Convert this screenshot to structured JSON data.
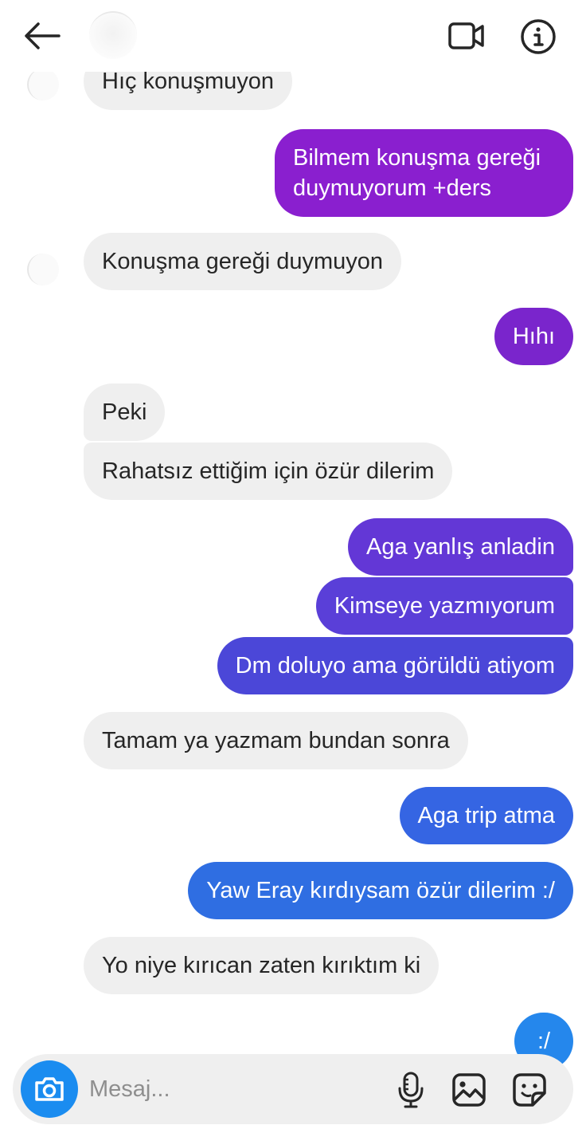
{
  "header": {
    "back_icon": "arrow-left-icon",
    "video_icon": "video-camera-icon",
    "info_icon": "info-icon"
  },
  "messages": [
    {
      "text": "Hıç konuşmuyon",
      "direction": "incoming",
      "color": "#efefef"
    },
    {
      "text": "Bilmem konuşma gereği\nduymuyorum +ders",
      "direction": "outgoing",
      "color": "#8a1fcf"
    },
    {
      "text": "Konuşma gereği duymuyon",
      "direction": "incoming",
      "color": "#efefef"
    },
    {
      "text": "Hıhı",
      "direction": "outgoing",
      "color": "#7a25cc"
    },
    {
      "text": "Peki",
      "direction": "incoming",
      "color": "#efefef"
    },
    {
      "text": "Rahatsız ettiğim için özür dilerim",
      "direction": "incoming",
      "color": "#efefef"
    },
    {
      "text": "Aga yanlış anladin",
      "direction": "outgoing",
      "color": "#6337d6"
    },
    {
      "text": "Kimseye yazmıyorum",
      "direction": "outgoing",
      "color": "#5a3fd8"
    },
    {
      "text": "Dm doluyo ama görüldü atiyom",
      "direction": "outgoing",
      "color": "#4b47d8"
    },
    {
      "text": "Tamam ya yazmam bundan sonra",
      "direction": "incoming",
      "color": "#efefef"
    },
    {
      "text": "Aga trip atma",
      "direction": "outgoing",
      "color": "#3565e3"
    },
    {
      "text": "Yaw Eray kırdıysam özür dilerim :/",
      "direction": "outgoing",
      "color": "#2f6ee2"
    },
    {
      "text": "Yo niye kırıcan zaten kırıktım ki",
      "direction": "incoming",
      "color": "#efefef"
    },
    {
      "text": ":/",
      "direction": "outgoing",
      "color": "#2587ec"
    }
  ],
  "composer": {
    "placeholder": "Mesaj...",
    "camera_icon": "camera-icon",
    "mic_icon": "microphone-icon",
    "gallery_icon": "image-gallery-icon",
    "sticker_icon": "sticker-icon",
    "accent": "#1a8cf0"
  }
}
